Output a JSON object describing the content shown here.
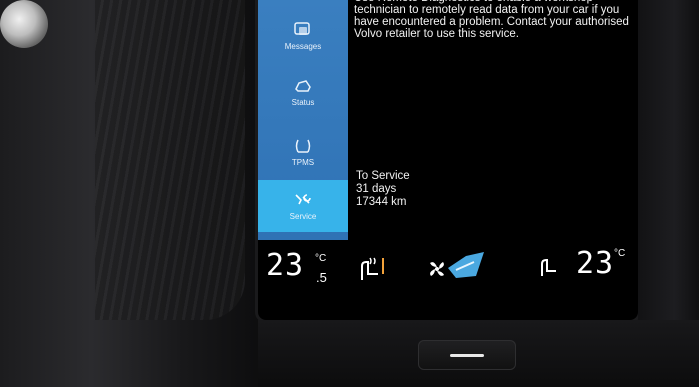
{
  "nav": {
    "items": [
      {
        "label": "Messages"
      },
      {
        "label": "Status"
      },
      {
        "label": "TPMS"
      },
      {
        "label": "Service"
      }
    ],
    "active": "Service"
  },
  "service": {
    "notice": "Use Remote Diagnostics to enable a workshop technician to remotely read data from your car if you have encountered a problem. Contact your authorised Volvo retailer to use this service.",
    "heading": "To Service",
    "days": "31 days",
    "distance": "17344 km"
  },
  "climate": {
    "left_temp": "23",
    "left_unit": "°C",
    "left_decimal": ".5",
    "right_temp": "23",
    "right_unit": "°C"
  },
  "colors": {
    "sidebar": "#2f72b5",
    "active_item": "#37b3ea",
    "accent": "#4aa8e0"
  },
  "icons": {
    "messages": "messages-icon",
    "status": "car-status-icon",
    "tpms": "tire-pressure-icon",
    "service": "wrench-service-icon",
    "seat_heat_left": "seat-heater-icon",
    "fan": "fan-icon",
    "climate": "climate-icon",
    "seat_right": "seat-icon"
  }
}
